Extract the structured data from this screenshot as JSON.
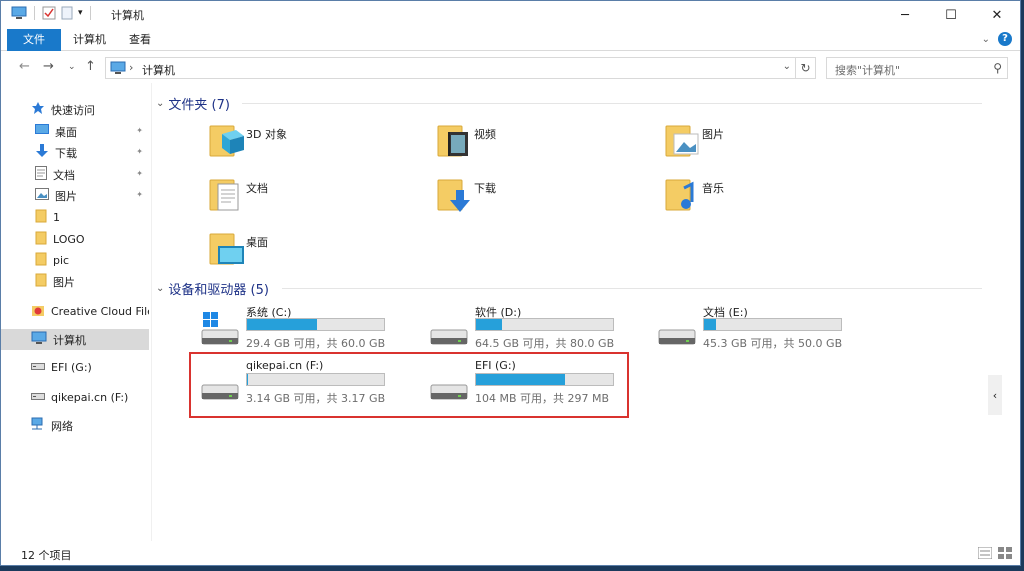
{
  "window": {
    "title": "计算机"
  },
  "ribbon": {
    "tabs": [
      "文件",
      "计算机",
      "查看"
    ]
  },
  "address": {
    "path": "计算机",
    "search_placeholder": "搜索\"计算机\""
  },
  "sidebar": {
    "items": [
      {
        "label": "快速访问",
        "icon": "star-icon"
      },
      {
        "label": "桌面",
        "icon": "desktop-icon",
        "pinned": true
      },
      {
        "label": "下载",
        "icon": "download-icon",
        "pinned": true
      },
      {
        "label": "文档",
        "icon": "documents-icon",
        "pinned": true
      },
      {
        "label": "图片",
        "icon": "pictures-icon",
        "pinned": true
      },
      {
        "label": "1",
        "icon": "folder-icon"
      },
      {
        "label": "LOGO",
        "icon": "folder-icon"
      },
      {
        "label": "pic",
        "icon": "folder-icon"
      },
      {
        "label": "图片",
        "icon": "folder-icon"
      },
      {
        "label": "Creative Cloud Files",
        "icon": "creative-cloud-icon"
      },
      {
        "label": "计算机",
        "icon": "computer-icon",
        "selected": true
      },
      {
        "label": "EFI (G:)",
        "icon": "drive-icon"
      },
      {
        "label": "qikepai.cn (F:)",
        "icon": "drive-icon"
      },
      {
        "label": "网络",
        "icon": "network-icon"
      }
    ]
  },
  "folders": {
    "header": "文件夹 (7)",
    "items": [
      {
        "label": "3D 对象",
        "icon": "3d-objects-icon"
      },
      {
        "label": "视频",
        "icon": "videos-icon"
      },
      {
        "label": "图片",
        "icon": "pictures-icon"
      },
      {
        "label": "文档",
        "icon": "documents-icon"
      },
      {
        "label": "下载",
        "icon": "downloads-icon"
      },
      {
        "label": "音乐",
        "icon": "music-icon"
      },
      {
        "label": "桌面",
        "icon": "desktop-icon"
      }
    ]
  },
  "drives": {
    "header": "设备和驱动器 (5)",
    "items": [
      {
        "name": "系统 (C:)",
        "info": "29.4 GB 可用，共 60.0 GB",
        "used_fraction": 0.51,
        "icon": "windows-drive-icon"
      },
      {
        "name": "软件 (D:)",
        "info": "64.5 GB 可用，共 80.0 GB",
        "used_fraction": 0.19,
        "icon": "drive-icon"
      },
      {
        "name": "文档 (E:)",
        "info": "45.3 GB 可用，共 50.0 GB",
        "used_fraction": 0.09,
        "icon": "drive-icon"
      },
      {
        "name": "qikepai.cn (F:)",
        "info": "3.14 GB 可用，共 3.17 GB",
        "used_fraction": 0.01,
        "icon": "drive-icon"
      },
      {
        "name": "EFI (G:)",
        "info": "104 MB 可用，共 297 MB",
        "used_fraction": 0.65,
        "icon": "drive-icon"
      }
    ]
  },
  "status": {
    "count": "12 个项目"
  },
  "colors": {
    "accent": "#1979ca",
    "bar": "#26a0da",
    "highlight": "#d9332f"
  }
}
